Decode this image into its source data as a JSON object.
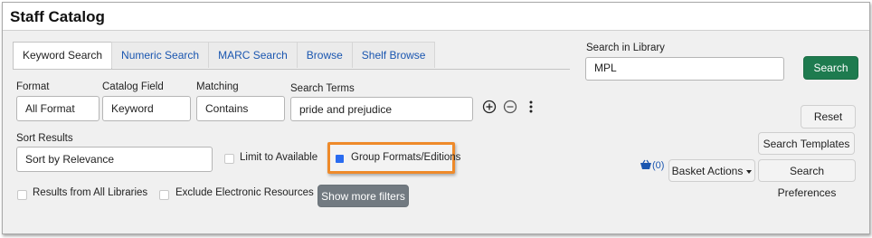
{
  "page": {
    "title": "Staff Catalog"
  },
  "tabs": [
    {
      "label": "Keyword Search",
      "active": true
    },
    {
      "label": "Numeric Search",
      "active": false
    },
    {
      "label": "MARC Search",
      "active": false
    },
    {
      "label": "Browse",
      "active": false
    },
    {
      "label": "Shelf Browse",
      "active": false
    }
  ],
  "search_row": {
    "format_label": "Format",
    "format_value": "All Format",
    "field_label": "Catalog Field",
    "field_value": "Keyword",
    "matching_label": "Matching",
    "matching_value": "Contains",
    "terms_label": "Search Terms",
    "terms_value": "pride and prejudice",
    "add_icon": "plus-circle-icon",
    "remove_icon": "minus-circle-icon",
    "more_icon": "vertical-ellipsis-icon"
  },
  "sort": {
    "label": "Sort Results",
    "value": "Sort by Relevance"
  },
  "filters": {
    "limit_available": "Limit to Available",
    "group_formats": "Group Formats/Editions",
    "all_libraries": "Results from All Libraries",
    "exclude_electronic": "Exclude Electronic Resources",
    "show_more": "Show more filters"
  },
  "library": {
    "label": "Search in Library",
    "value": "MPL"
  },
  "buttons": {
    "search": "Search",
    "reset": "Reset",
    "search_templates": "Search Templates",
    "basket_actions": "Basket Actions",
    "search_preferences": "Search Preferences"
  },
  "basket": {
    "icon": "basket-icon",
    "count": "(0)"
  },
  "colors": {
    "accent_green": "#1e7b4f",
    "highlight_orange": "#ee8a2a",
    "link_blue": "#1a56b0"
  }
}
